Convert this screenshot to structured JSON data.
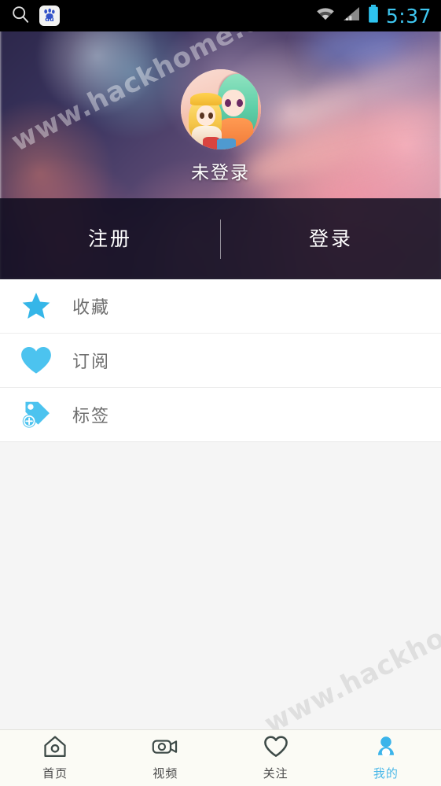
{
  "statusbar": {
    "time": "5:37",
    "icons": {
      "search": "search-icon",
      "baidu": "baidu-logo-icon",
      "baidu_text": "du",
      "wifi": "wifi-icon",
      "signal": "cellular-signal-icon",
      "battery": "battery-icon"
    },
    "accent_color": "#3ec6ef",
    "background_color": "#000000"
  },
  "profile": {
    "avatar_alt": "anime-characters-avatar",
    "nickname": "未登录"
  },
  "auth": {
    "register_label": "注册",
    "login_label": "登录"
  },
  "menu": {
    "items": [
      {
        "label": "收藏",
        "icon": "star-icon",
        "color": "#35b6e8"
      },
      {
        "label": "订阅",
        "icon": "heart-icon",
        "color": "#4cc3ef"
      },
      {
        "label": "标签",
        "icon": "tag-plus-icon",
        "color": "#4cc3ef"
      }
    ]
  },
  "bottom_nav": {
    "active_index": 3,
    "active_color": "#4bb8e8",
    "inactive_color": "#4a4a4a",
    "items": [
      {
        "label": "首页",
        "icon": "home-icon"
      },
      {
        "label": "视频",
        "icon": "video-camera-icon"
      },
      {
        "label": "关注",
        "icon": "heart-outline-icon"
      },
      {
        "label": "我的",
        "icon": "person-icon"
      }
    ]
  },
  "watermarks": {
    "top": "www.hackhome.com",
    "bottom": "www.hackhome.com",
    "mid": "www.hackhome.com"
  }
}
